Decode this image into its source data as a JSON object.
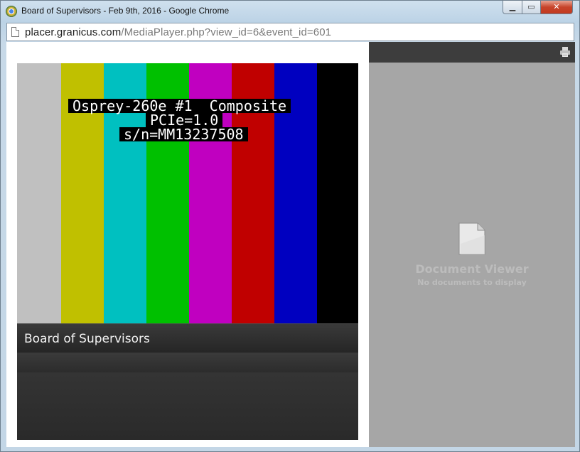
{
  "window": {
    "title": "Board of Supervisors - Feb 9th, 2016 - Google Chrome",
    "minimize_glyph": "▁",
    "maximize_glyph": "▭",
    "close_glyph": "✕",
    "app_icon": "chrome-icon"
  },
  "address_bar": {
    "url_host": "placer.granicus.com",
    "url_path": "/MediaPlayer.php?view_id=6&event_id=601",
    "page_icon": "page-icon"
  },
  "video": {
    "test_pattern_colors": [
      "#c0c0c0",
      "#c0c000",
      "#00c0c0",
      "#00c000",
      "#c000c0",
      "#c00000",
      "#0000c0",
      "#000000"
    ],
    "overlay_lines": [
      "Osprey-260e #1  Composite",
      "PCIe=1.0",
      "s/n=MM13237508"
    ]
  },
  "player": {
    "event_title": "Board of Supervisors"
  },
  "document_viewer": {
    "title": "Document Viewer",
    "subtitle": "No documents to display",
    "print_icon": "print-icon",
    "doc_icon": "document-icon"
  }
}
